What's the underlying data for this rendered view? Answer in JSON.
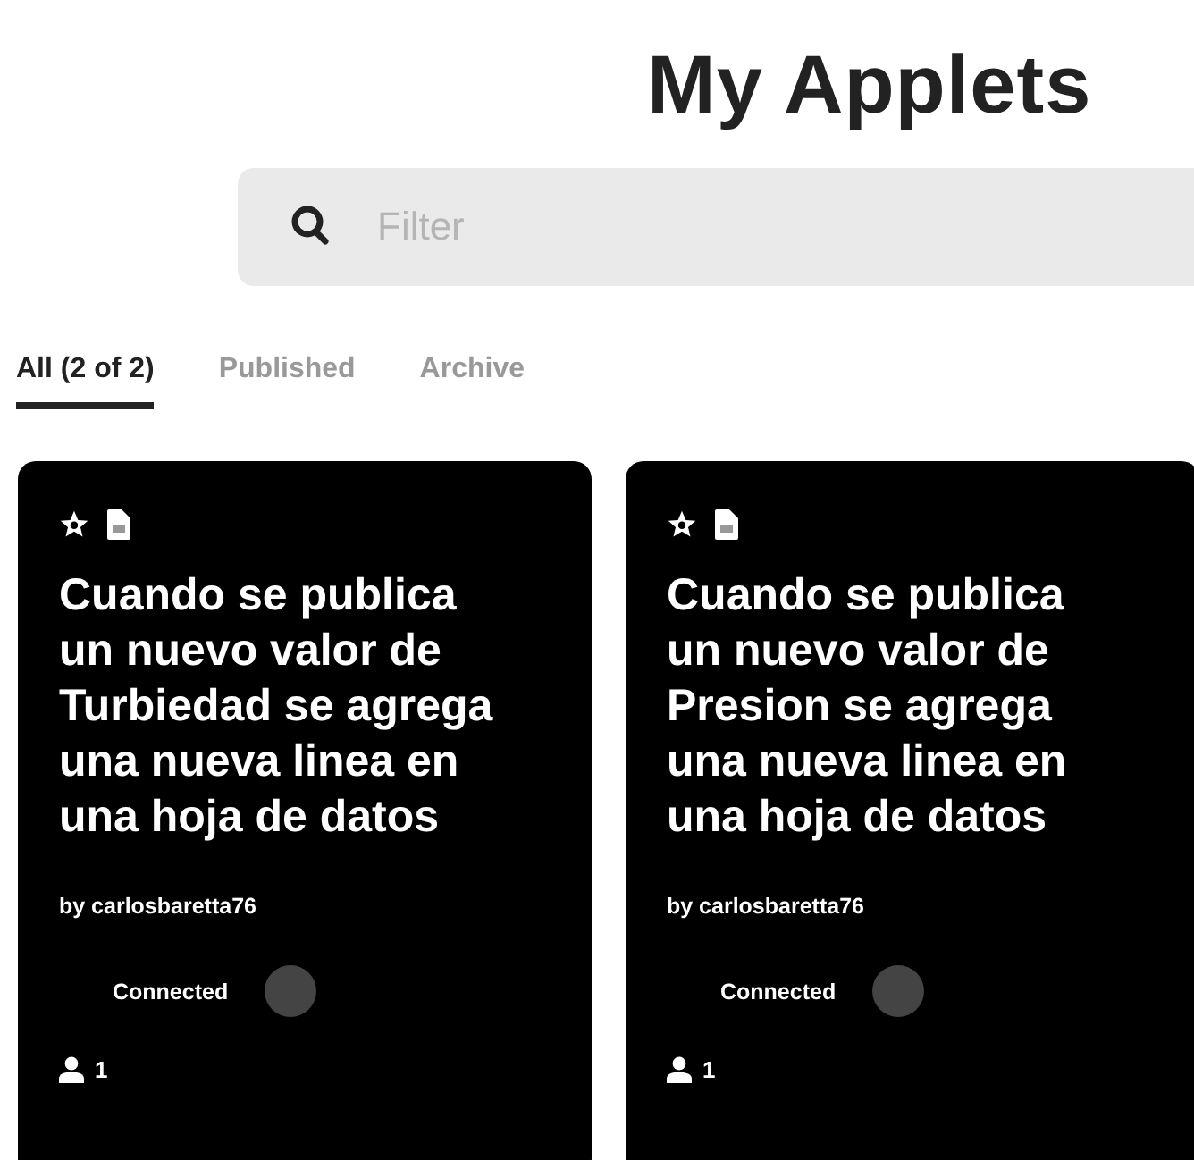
{
  "title": "My Applets",
  "search": {
    "placeholder": "Filter"
  },
  "tabs": [
    {
      "label": "All (2 of 2)",
      "selected": true
    },
    {
      "label": "Published",
      "selected": false
    },
    {
      "label": "Archive",
      "selected": false
    }
  ],
  "applets": [
    {
      "title": "Cuando se publica un nuevo valor de Turbiedad se agrega una nueva linea en una hoja de datos",
      "author": "by carlosbaretta76",
      "status": "Connected",
      "users": "1"
    },
    {
      "title": "Cuando se publica un nuevo valor de Presion se agrega una nueva linea en una hoja de datos",
      "author": "by carlosbaretta76",
      "status": "Connected",
      "users": "1"
    }
  ]
}
